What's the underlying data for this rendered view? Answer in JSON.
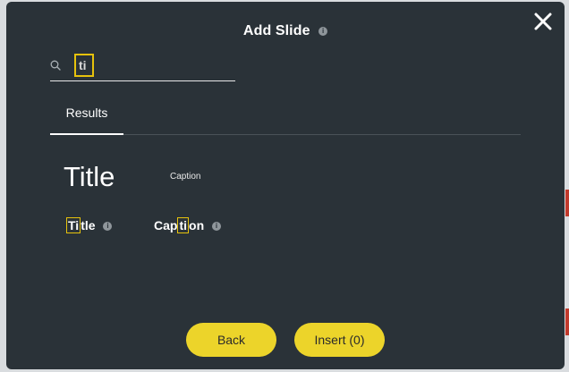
{
  "dialog": {
    "title": "Add Slide",
    "info_icon": "i",
    "close_icon": "close-icon"
  },
  "search": {
    "value": "ti",
    "placeholder": ""
  },
  "tabs": [
    {
      "label": "Results",
      "active": true
    }
  ],
  "preview": {
    "title_text": "Title",
    "caption_text": "Caption"
  },
  "results": [
    {
      "prefix": "",
      "match": "Ti",
      "suffix": "tle",
      "info": "i"
    },
    {
      "prefix": "Cap",
      "match": "ti",
      "suffix": "on",
      "info": "i"
    }
  ],
  "buttons": {
    "back_label": "Back",
    "insert_label": "Insert (0)"
  },
  "colors": {
    "modal_bg": "#2a3238",
    "accent_yellow": "#ecd42a",
    "highlight": "#e6c20c",
    "page_bg": "#d9dcdf"
  }
}
